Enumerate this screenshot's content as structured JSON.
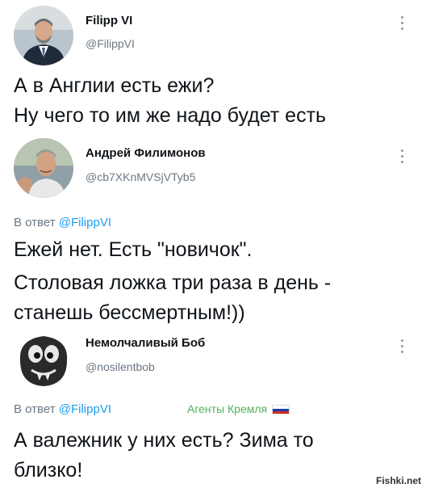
{
  "colors": {
    "link": "#1d9bf0",
    "muted": "#6b7783",
    "agents": "#4fb35b"
  },
  "tweets": [
    {
      "name": "Filipp VI",
      "handle": "@FilippVI",
      "lines": [
        "А в Англии есть ежи?",
        "Ну чего то им же надо будет есть"
      ]
    },
    {
      "name": "Андрей Филимонов",
      "handle": "@cb7XKnMVSjVTyb5",
      "reply_prefix": "В ответ",
      "reply_to": "@FilippVI",
      "lines": [
        "Ежей нет. Есть \"новичок\".",
        "Столовая ложка три раза в день -",
        "станешь бессмертным!))"
      ]
    },
    {
      "name": "Немолчаливый Боб",
      "handle": "@nosilentbob",
      "reply_prefix": "В ответ",
      "reply_to": "@FilippVI",
      "badge": "Агенты Кремля",
      "lines": [
        "А валежник у них есть? Зима то",
        "близко!"
      ]
    }
  ],
  "icons": {
    "menu": "more-vertical-icon",
    "flag": "russian-flag-icon"
  },
  "watermark": "Fishki.net"
}
